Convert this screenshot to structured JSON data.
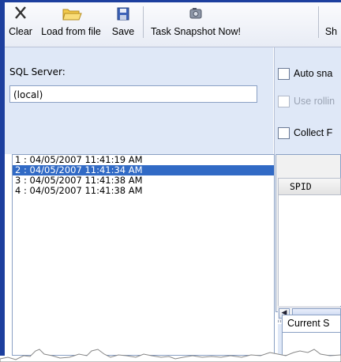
{
  "toolbar": {
    "clear": {
      "label": "Clear",
      "icon": "close-x-icon"
    },
    "load": {
      "label": "Load from file",
      "icon": "folder-open-icon"
    },
    "save": {
      "label": "Save",
      "icon": "floppy-disk-icon"
    },
    "snapshot": {
      "label": "Task Snapshot Now!",
      "icon": "camera-icon"
    },
    "cut": {
      "label": "Sh"
    }
  },
  "connection": {
    "server_label": "SQL Server:",
    "server_value": "(local)"
  },
  "options": {
    "auto_snapshot": "Auto sna",
    "use_rolling": "Use rollin",
    "collect": "Collect F"
  },
  "snapshots": [
    {
      "label": "1 : 04/05/2007 11:41:19 AM",
      "selected": false
    },
    {
      "label": "2 : 04/05/2007 11:41:34 AM",
      "selected": true
    },
    {
      "label": "3 : 04/05/2007 11:41:38 AM",
      "selected": false
    },
    {
      "label": "4 : 04/05/2007 11:41:38 AM",
      "selected": false
    }
  ],
  "grid": {
    "column": "SPID"
  },
  "tabs": {
    "current": "Current S"
  },
  "colors": {
    "frame": "#1d3f9e",
    "panel": "#dfe8f7",
    "selection": "#316ac5"
  }
}
